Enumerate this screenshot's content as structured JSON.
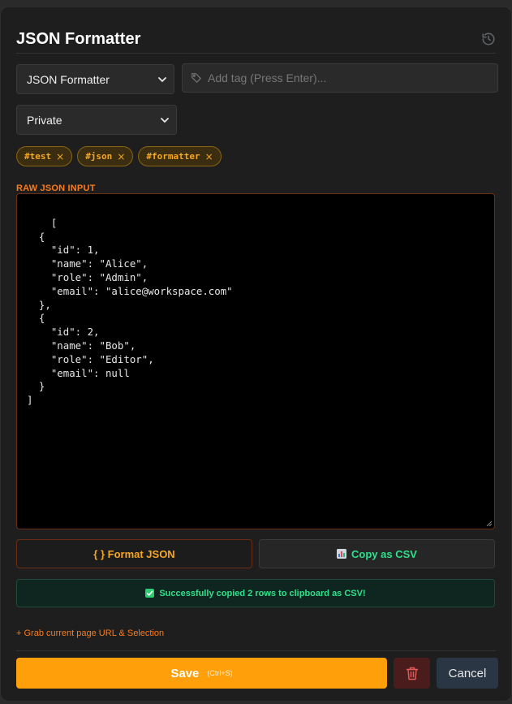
{
  "header": {
    "title": "JSON Formatter",
    "history_icon": "history-icon"
  },
  "controls": {
    "tool_select": {
      "value": "JSON Formatter"
    },
    "tag_input": {
      "placeholder": "Add tag (Press Enter)..."
    },
    "visibility_select": {
      "value": "Private"
    }
  },
  "tags": [
    {
      "label": "#test",
      "remove": "×"
    },
    {
      "label": "#json",
      "remove": "×"
    },
    {
      "label": "#formatter",
      "remove": "×"
    }
  ],
  "editor": {
    "label": "RAW JSON INPUT",
    "content": "[\n  {\n    \"id\": 1,\n    \"name\": \"Alice\",\n    \"role\": \"Admin\",\n    \"email\": \"alice@workspace.com\"\n  },\n  {\n    \"id\": 2,\n    \"name\": \"Bob\",\n    \"role\": \"Editor\",\n    \"email\": null\n  }\n]"
  },
  "actions": {
    "format_label": "{ } Format JSON",
    "copy_csv_label": "Copy as CSV"
  },
  "status": {
    "success_message": "Successfully copied 2 rows to clipboard as CSV!"
  },
  "links": {
    "grab_label": "+ Grab current page URL & Selection"
  },
  "footer": {
    "save_label": "Save",
    "save_shortcut": "(Ctrl+S)",
    "cancel_label": "Cancel"
  },
  "colors": {
    "accent_orange": "#ff9f0a",
    "success_green": "#2ee08a",
    "danger_bg": "#4a1c1c",
    "panel_bg": "#1e1e1e"
  }
}
